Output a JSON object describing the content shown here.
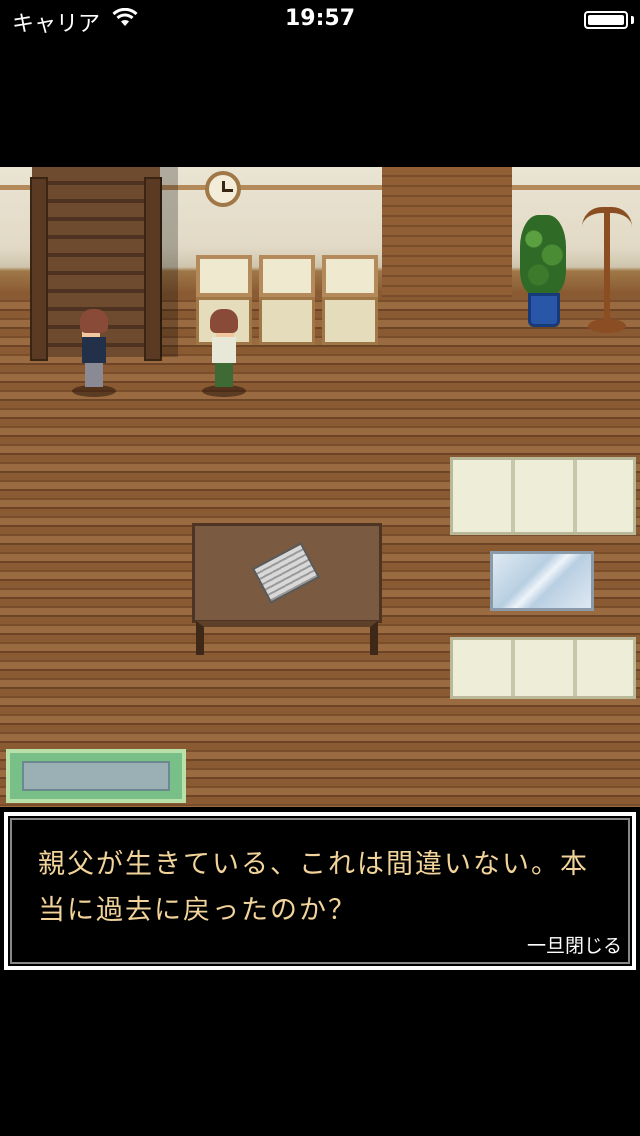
{
  "status_bar": {
    "carrier": "キャリア",
    "time": "19:57",
    "battery_level": 1.0,
    "icons": [
      "wifi-icon",
      "battery-icon"
    ]
  },
  "scene": {
    "objects": [
      "staircase",
      "wall-clock",
      "chair",
      "chair",
      "chair",
      "potted-plant",
      "coat-rack",
      "character",
      "character",
      "coffee-table",
      "newspaper",
      "sofa",
      "glass-table",
      "sofa",
      "rug"
    ]
  },
  "message_window": {
    "text": "親父が生きている、これは間違いない。本当に過去に戻ったのか？",
    "close_label": "一旦閉じる"
  },
  "colors": {
    "message_text": "#f2d39a",
    "floor": "#8a5a33"
  }
}
